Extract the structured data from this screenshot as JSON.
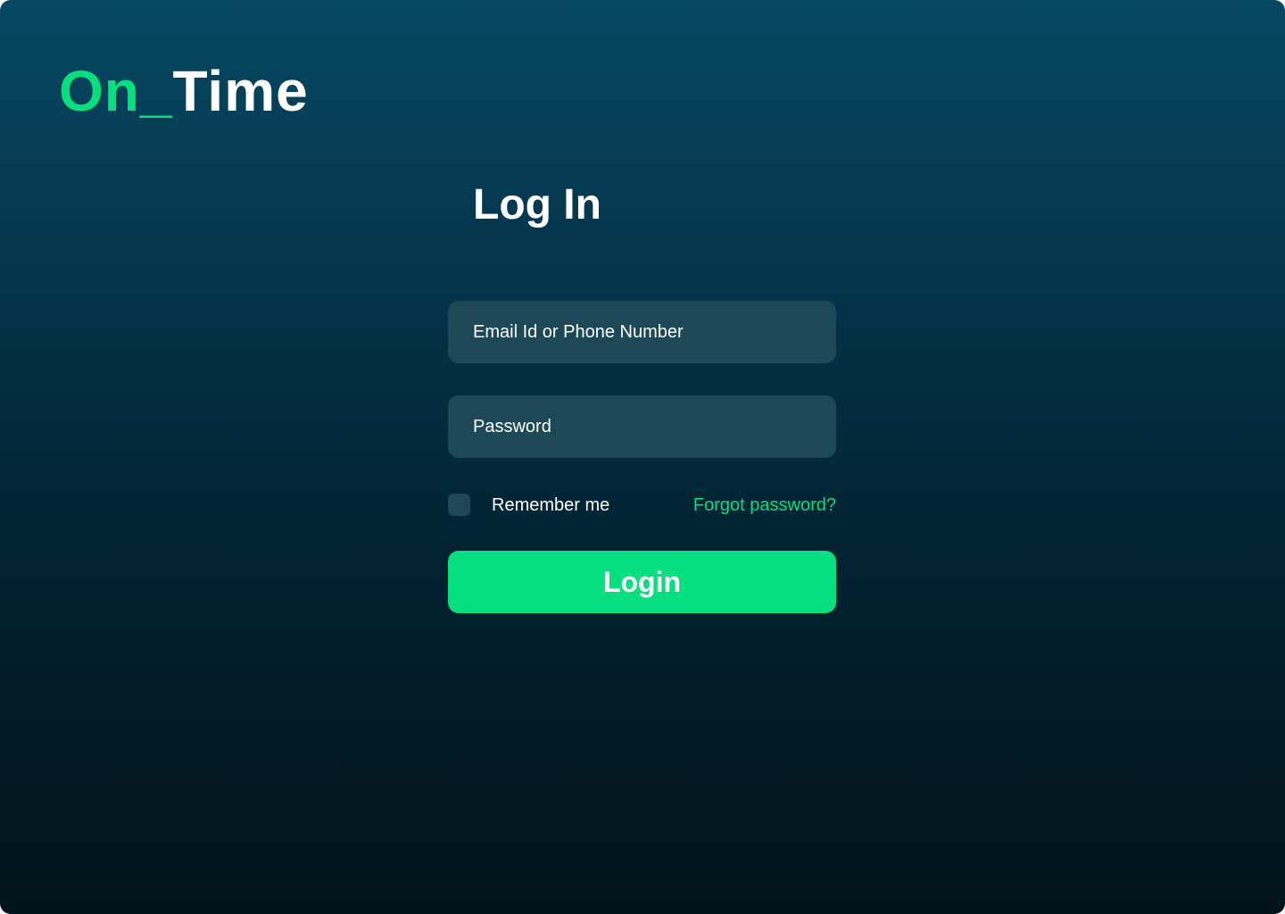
{
  "brand": {
    "name_accent": "On_",
    "name_main": "Time",
    "accent_color": "#06df7d"
  },
  "login_form": {
    "title": "Log In",
    "email_placeholder": "Email Id or Phone Number",
    "password_placeholder": "Password",
    "remember_label": "Remember me",
    "remember_checked": false,
    "forgot_label": "Forgot password?",
    "submit_label": "Login"
  },
  "colors": {
    "background_top": "#074862",
    "background_bottom": "#011419",
    "field_background": "#1d4858",
    "accent": "#06df7d",
    "text": "#ffffff"
  }
}
